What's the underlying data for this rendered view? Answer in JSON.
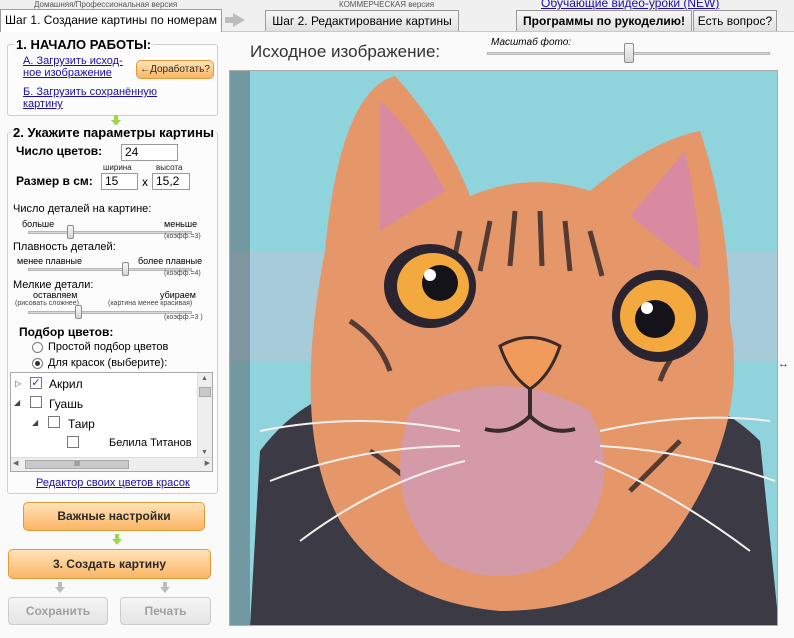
{
  "top": {
    "home_pro_label": "Домашняя/Профессиональная версия",
    "commercial_label": "КОММЕРЧЕСКАЯ версия",
    "video_link": "Обучающие видео-уроки (NEW)",
    "tab_step1": "Шаг 1. Создание картины по номерам",
    "tab_step2": "Шаг 2. Редактирование картины",
    "tab_programs": "Программы по рукоделию!",
    "tab_question": "Есть вопрос?"
  },
  "start": {
    "title": "1. НАЧАЛО РАБОТЫ:",
    "load_image_line1": "А. Загрузить исход-",
    "load_image_line2": "ное изображение",
    "refine_button": "←Доработать?",
    "load_saved_line1": "Б. Загрузить сохранённую",
    "load_saved_line2": "картину"
  },
  "params": {
    "title": "2. Укажите параметры картины",
    "colors_label": "Число цветов:",
    "colors_value": "24",
    "size_label": "Размер в см:",
    "width_label": "ширина",
    "height_label": "высота",
    "width_value": "15",
    "height_value": "15,2",
    "times_sign": "x",
    "details_label": "Число деталей на картине:",
    "details_left": "больше",
    "details_right": "меньше",
    "details_coef": "(коэфф.=3)",
    "details_level": 0.25,
    "smooth_label": "Плавность деталей:",
    "smooth_left": "менее плавные",
    "smooth_right": "более плавные",
    "smooth_coef": "(коэфф.=4)",
    "smooth_level": 0.6,
    "small_label": "Мелкие детали:",
    "small_left": "оставляем",
    "small_left_note": "(рисовать сложнее)",
    "small_right": "убираем",
    "small_right_note": "(картина менее красивая)",
    "small_coef": "(коэфф.=3 )",
    "small_level": 0.3,
    "colors_pick_label": "Подбор цветов:",
    "radio_simple": "Простой подбор цветов",
    "radio_paints": "Для красок (выберите):",
    "tree": [
      {
        "label": "Акрил",
        "checked": true
      },
      {
        "label": "Гуашь",
        "checked": false
      },
      {
        "label": "Таир",
        "checked": false
      },
      {
        "label": "Белила Титанов",
        "checked": false
      }
    ],
    "hscroll_grip": "III",
    "editor_link": "Редактор своих цветов красок"
  },
  "buttons": {
    "important": "Важные настройки",
    "create": "3. Создать картину",
    "save": "Сохранить",
    "print": "Печать"
  },
  "view": {
    "source_title": "Исходное изображение:",
    "scale_label": "Масштаб фото:",
    "scale_level": 0.5
  },
  "colors": {
    "accent_orange": "#fbb564",
    "link": "#1a0dab"
  }
}
